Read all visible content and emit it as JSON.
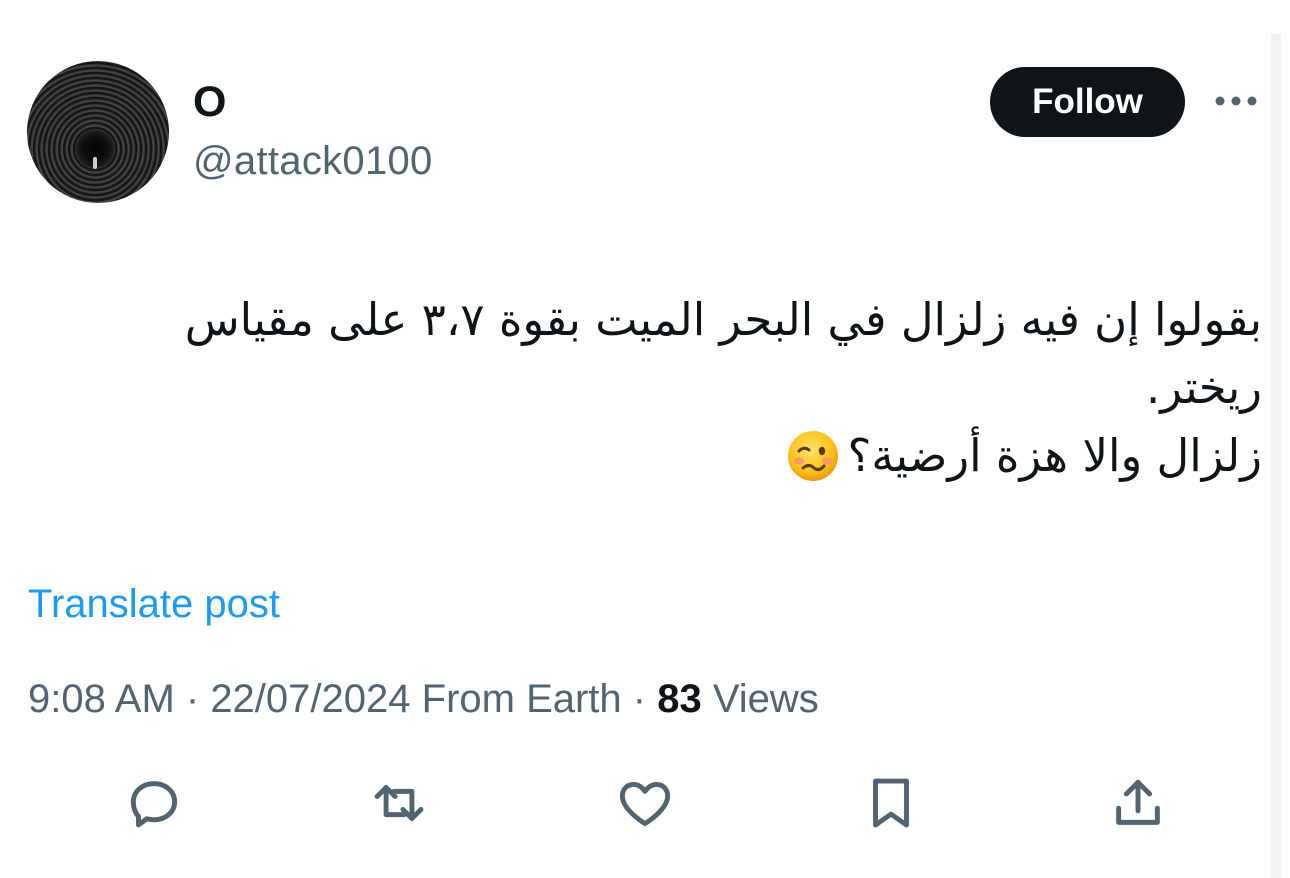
{
  "author": {
    "display_name": "O",
    "handle": "@attack0100",
    "avatar_icon": "avatar-image"
  },
  "header": {
    "follow_label": "Follow",
    "more_icon": "more-icon"
  },
  "tweet": {
    "lines": [
      "بقولوا إن فيه زلزال في البحر الميت بقوة  ٣،٧ على مقياس",
      "ريختر.",
      "زلزال والا هزة أرضية؟"
    ],
    "emoji_icon": "woozy-face-emoji"
  },
  "translate_label": "Translate post",
  "meta": {
    "time": "9:08 AM",
    "sep1": " · ",
    "date": "22/07/2024",
    "source": " From Earth",
    "sep2": " · ",
    "views_count": "83",
    "views_label": " Views"
  },
  "actions": {
    "reply_icon": "reply-icon",
    "repost_icon": "repost-icon",
    "like_icon": "heart-icon",
    "bookmark_icon": "bookmark-icon",
    "share_icon": "share-icon"
  },
  "colors": {
    "text_primary": "#0f1419",
    "text_secondary": "#536471",
    "link": "#1d9bf0",
    "follow_bg": "#0f1419"
  }
}
